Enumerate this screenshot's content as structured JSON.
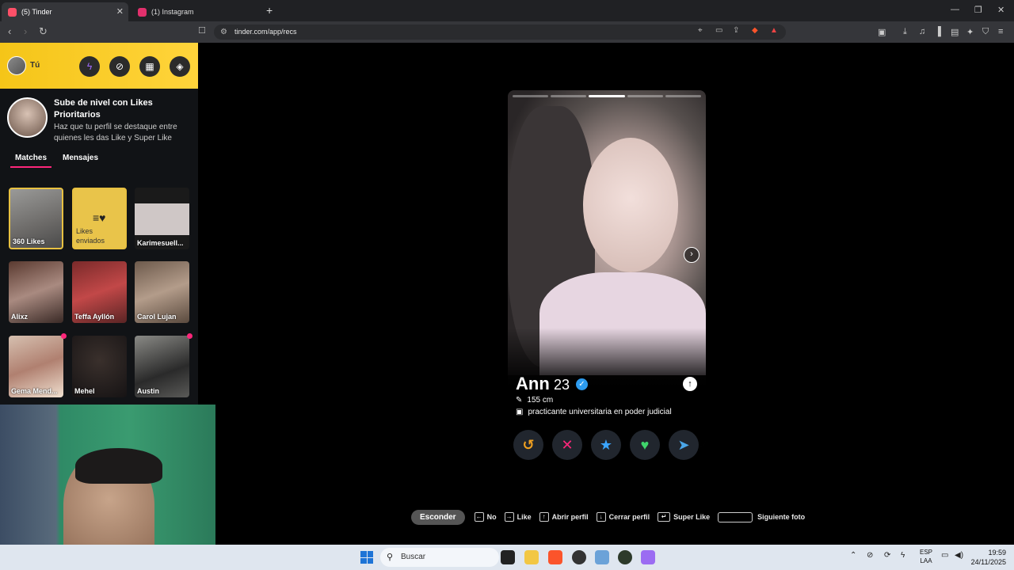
{
  "browser": {
    "tabs": [
      {
        "title": "(5) Tinder",
        "favicon_color": "#fd5068"
      },
      {
        "title": "(1) Instagram",
        "favicon_color": "#e1306c"
      }
    ],
    "url": "tinder.com/app/recs"
  },
  "sidebar": {
    "user_label": "Tú",
    "promo_title": "Sube de nivel con Likes Prioritarios",
    "promo_subtitle": "Haz que tu perfil se destaque entre quienes les das Like y Super Like",
    "tabs": [
      "Matches",
      "Mensajes"
    ],
    "tiles": [
      {
        "label": "360 Likes"
      },
      {
        "label": "Likes enviados"
      },
      {
        "label": "Karimesuell..."
      },
      {
        "label": "Alixz"
      },
      {
        "label": "Teffa Ayllón"
      },
      {
        "label": "Carol Lujan"
      },
      {
        "label": "Gema Mend..."
      },
      {
        "label": "Mehel"
      },
      {
        "label": "Austin"
      }
    ]
  },
  "profile": {
    "name": "Ann",
    "age": "23",
    "height": "155 cm",
    "job": "practicante universitaria en poder judicial"
  },
  "shortcuts": {
    "hide": "Esconder",
    "no": "No",
    "like": "Like",
    "open": "Abrir perfil",
    "close": "Cerrar perfil",
    "superlike": "Super Like",
    "next_photo": "Siguiente foto"
  },
  "taskbar": {
    "search_placeholder": "Buscar",
    "lang_top": "ESP",
    "lang_bottom": "LAA",
    "time": "19:59",
    "date": "24/11/2025"
  },
  "colors": {
    "brand": "#fd267a",
    "gold": "#f5c518"
  }
}
